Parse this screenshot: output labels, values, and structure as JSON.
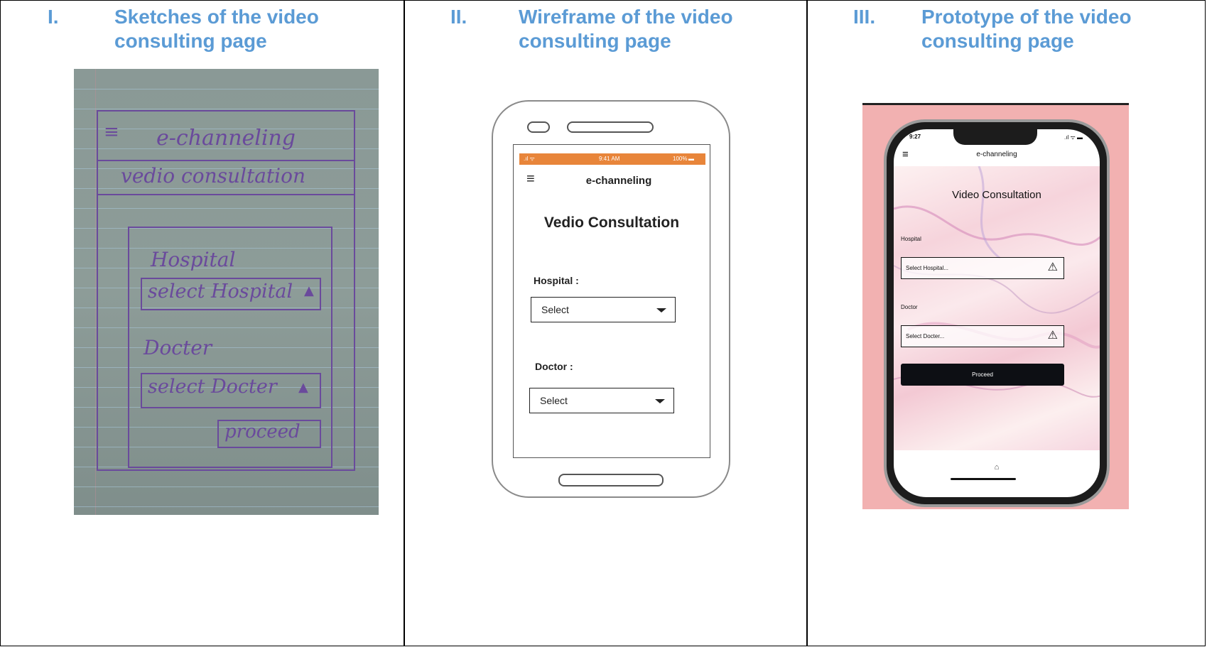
{
  "columns": [
    {
      "numeral": "I.",
      "title": "Sketches of the video consulting page"
    },
    {
      "numeral": "II.",
      "title": "Wireframe of the video consulting page"
    },
    {
      "numeral": "III.",
      "title": "Prototype of the video consulting page"
    }
  ],
  "sketch": {
    "app": "e-channeling",
    "heading": "vedio consultation",
    "hospital_label": "Hospital",
    "hospital_select": "select Hospital",
    "doctor_label": "Docter",
    "doctor_select": "select Docter",
    "proceed": "proceed",
    "ink_color": "#6a4a9c"
  },
  "wireframe": {
    "status_time": "9:41 AM",
    "status_battery": "100%",
    "app_title": "e-channeling",
    "page_title": "Vedio Consultation",
    "hospital_label": "Hospital :",
    "hospital_select": "Select",
    "doctor_label": "Doctor :",
    "doctor_select": "Select",
    "status_color": "#e8853a"
  },
  "prototype": {
    "time": "9:27",
    "signal": ".ıl ᯤ ▬",
    "app_title": "e-channeling",
    "page_title": "Video Consultation",
    "hospital_label": "Hospital",
    "hospital_placeholder": "Select Hospital...",
    "doctor_label": "Doctor",
    "doctor_placeholder": "Select Docter...",
    "proceed": "Proceed",
    "background_color": "#f2b1b1",
    "button_color": "#0d0f14"
  },
  "header_color": "#5b9bd5"
}
